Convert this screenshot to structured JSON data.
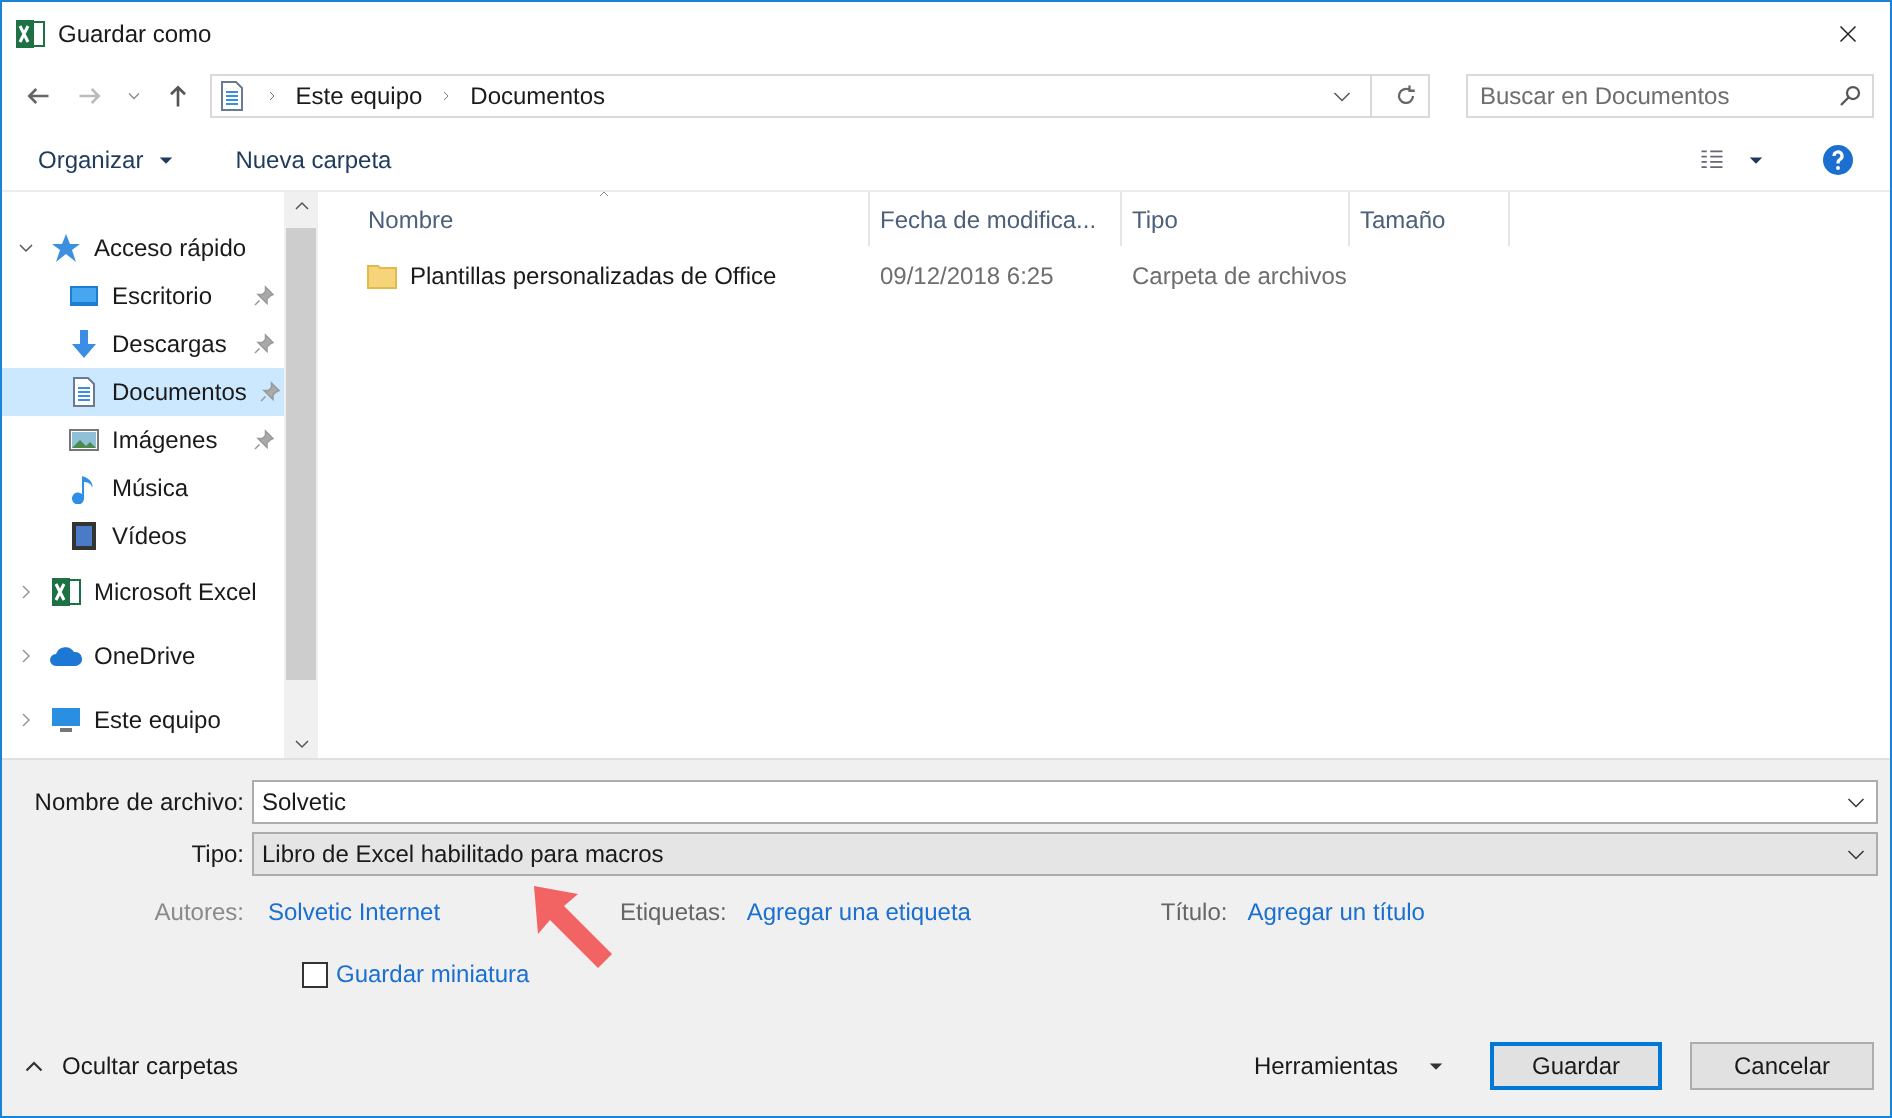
{
  "window": {
    "title": "Guardar como"
  },
  "address": {
    "crumbs": [
      "Este equipo",
      "Documentos"
    ]
  },
  "search": {
    "placeholder": "Buscar en Documentos"
  },
  "toolbar": {
    "organize": "Organizar",
    "new_folder": "Nueva carpeta"
  },
  "sidebar": {
    "items": [
      {
        "label": "Acceso rápido",
        "kind": "star",
        "expanded": true,
        "selected": false,
        "children": [
          {
            "label": "Escritorio",
            "kind": "desktop",
            "pinned": true,
            "selected": false
          },
          {
            "label": "Descargas",
            "kind": "download",
            "pinned": true,
            "selected": false
          },
          {
            "label": "Documentos",
            "kind": "document",
            "pinned": true,
            "selected": true
          },
          {
            "label": "Imágenes",
            "kind": "image",
            "pinned": true,
            "selected": false
          },
          {
            "label": "Música",
            "kind": "music",
            "pinned": false,
            "selected": false
          },
          {
            "label": "Vídeos",
            "kind": "video",
            "pinned": false,
            "selected": false
          }
        ]
      },
      {
        "label": "Microsoft Excel",
        "kind": "excel",
        "expanded": false,
        "selected": false
      },
      {
        "label": "OneDrive",
        "kind": "cloud",
        "expanded": false,
        "selected": false
      },
      {
        "label": "Este equipo",
        "kind": "computer",
        "expanded": false,
        "selected": false
      }
    ]
  },
  "table": {
    "columns": [
      "Nombre",
      "Fecha de modifica...",
      "Tipo",
      "Tamaño"
    ],
    "rows": [
      {
        "name": "Plantillas personalizadas de Office",
        "date": "09/12/2018 6:25",
        "type": "Carpeta de archivos",
        "size": ""
      }
    ]
  },
  "form": {
    "filename_label": "Nombre de archivo:",
    "filename": "Solvetic",
    "type_label": "Tipo:",
    "type": "Libro de Excel habilitado para macros",
    "authors_label": "Autores:",
    "authors": "Solvetic Internet",
    "tags_label": "Etiquetas:",
    "tags": "Agregar una etiqueta",
    "title_label": "Título:",
    "title": "Agregar un título",
    "thumbnail": {
      "label": "Guardar miniatura",
      "checked": false
    }
  },
  "footer": {
    "hide_folders": "Ocultar carpetas",
    "tools": "Herramientas",
    "save": "Guardar",
    "cancel": "Cancelar"
  }
}
